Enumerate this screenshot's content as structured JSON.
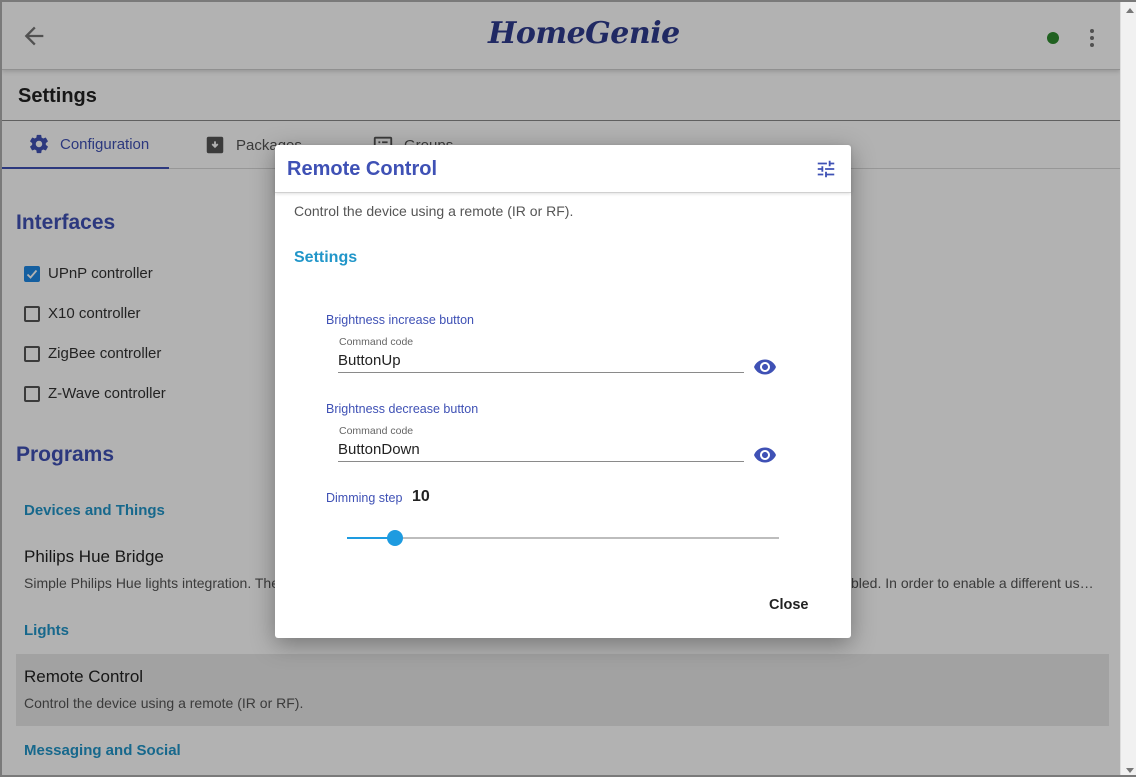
{
  "header": {
    "brand": "HomeGenie",
    "status_color": "#2e8b2e"
  },
  "settings": {
    "title": "Settings"
  },
  "tabs": [
    {
      "label": "Configuration",
      "icon": "gear-icon",
      "active": true
    },
    {
      "label": "Packages",
      "icon": "archive-icon",
      "active": false
    },
    {
      "label": "Groups",
      "icon": "list-icon",
      "active": false
    }
  ],
  "interfaces": {
    "title": "Interfaces",
    "items": [
      {
        "label": "UPnP controller",
        "checked": true
      },
      {
        "label": "X10 controller",
        "checked": false
      },
      {
        "label": "ZigBee controller",
        "checked": false
      },
      {
        "label": "Z-Wave controller",
        "checked": false
      }
    ]
  },
  "programs": {
    "title": "Programs",
    "groups": [
      {
        "label": "Devices and Things"
      },
      {
        "label": "Lights"
      },
      {
        "label": "Messaging and Social"
      }
    ],
    "items": [
      {
        "title": "Philips Hue Bridge",
        "desc_left": "Simple Philips Hue lights integration. The",
        "desc_right": "bled. In order to enable a different us…"
      },
      {
        "title": "Remote Control",
        "desc": "Control the device using a remote (IR or RF)."
      }
    ]
  },
  "dialog": {
    "title": "Remote Control",
    "description": "Control the device using a remote (IR or RF).",
    "section": "Settings",
    "fields": [
      {
        "group_label": "Brightness increase button",
        "label": "Command code",
        "value": "ButtonUp"
      },
      {
        "group_label": "Brightness decrease button",
        "label": "Command code",
        "value": "ButtonDown"
      }
    ],
    "dimming": {
      "label": "Dimming step",
      "value": "10",
      "fraction": 0.11
    },
    "close_label": "Close"
  },
  "colors": {
    "primary": "#3f51b5",
    "accent": "#2196c9",
    "slider": "#1e9be0"
  }
}
